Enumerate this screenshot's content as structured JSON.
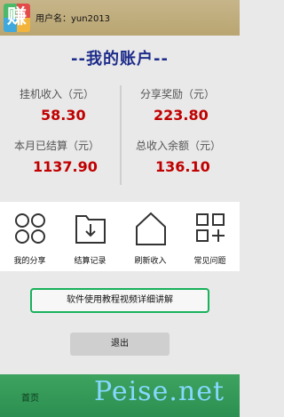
{
  "header": {
    "logo_char": "赚",
    "username_label": "用户名：yun2013"
  },
  "page_title": "--我的账户--",
  "stats": [
    {
      "label": "挂机收入（元）",
      "value": "58.30"
    },
    {
      "label": "分享奖励（元）",
      "value": "223.80"
    },
    {
      "label": "本月已结算（元）",
      "value": "1137.90"
    },
    {
      "label": "总收入余额（元）",
      "value": "136.10"
    }
  ],
  "grid": [
    {
      "label": "我的分享",
      "icon": "four-circles-icon"
    },
    {
      "label": "结算记录",
      "icon": "download-folder-icon"
    },
    {
      "label": "刷新收入",
      "icon": "house-icon"
    },
    {
      "label": "常见问题",
      "icon": "squares-plus-icon"
    }
  ],
  "tutorial_button": "软件使用教程视频详细讲解",
  "logout_button": "退出",
  "bottom_bar": {
    "home_label": "首页",
    "watermark": "Peise.net"
  },
  "colors": {
    "header": "#bfae80",
    "title": "#1d2c8a",
    "value": "#c00000",
    "accent_green": "#18b15c",
    "bottom_bar": "#34995a"
  }
}
